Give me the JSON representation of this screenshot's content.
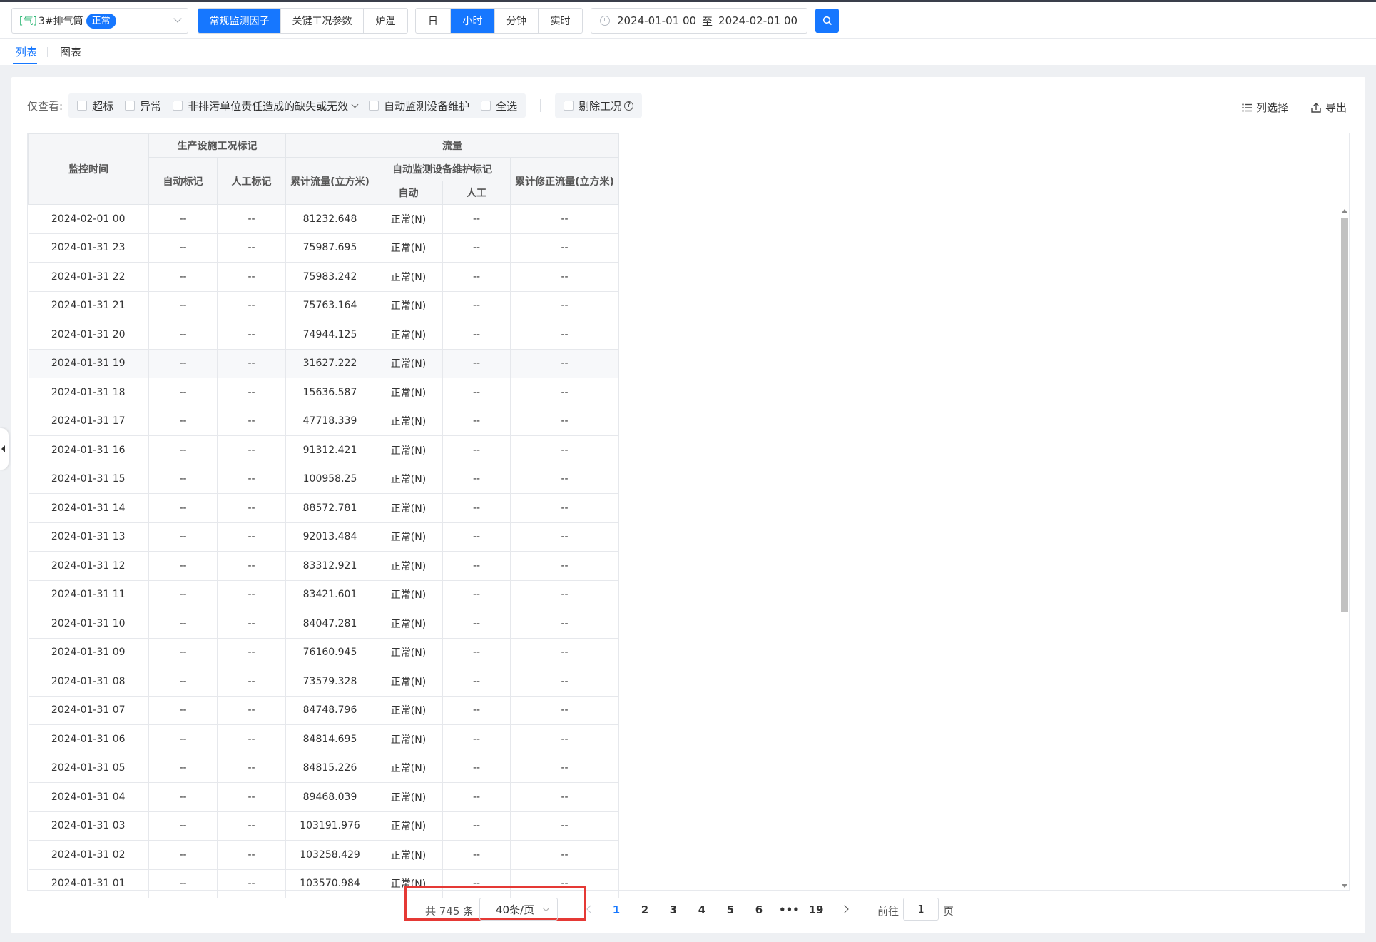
{
  "toolbar": {
    "outlet": {
      "type": "[气]",
      "name": "3#排气筒",
      "status": "正常"
    },
    "factor_tabs": [
      {
        "label": "常规监测因子",
        "active": true
      },
      {
        "label": "关键工况参数",
        "active": false
      },
      {
        "label": "炉温",
        "active": false
      }
    ],
    "granularity": [
      {
        "label": "日",
        "active": false
      },
      {
        "label": "小时",
        "active": true
      },
      {
        "label": "分钟",
        "active": false
      },
      {
        "label": "实时",
        "active": false
      }
    ],
    "date_start": "2024-01-01 00",
    "date_sep": "至",
    "date_end": "2024-02-01 00"
  },
  "view_tabs": [
    {
      "label": "列表",
      "active": true
    },
    {
      "label": "图表",
      "active": false
    }
  ],
  "filters": {
    "label": "仅查看:",
    "options": [
      "超标",
      "异常",
      "非排污单位责任造成的缺失或无效",
      "自动监测设备维护",
      "全选"
    ],
    "exclude": "剔除工况",
    "column_select": "列选择",
    "export": "导出"
  },
  "table": {
    "headers": {
      "time": "监控时间",
      "production_group": "生产设施工况标记",
      "auto_mark": "自动标记",
      "manual_mark": "人工标记",
      "flow_group": "流量",
      "cum_flow": "累计流量(立方米)",
      "maint_group": "自动监测设备维护标记",
      "maint_auto": "自动",
      "maint_manual": "人工",
      "cum_corrected": "累计修正流量(立方米)"
    },
    "rows": [
      [
        "2024-02-01 00",
        "--",
        "--",
        "81232.648",
        "正常(N)",
        "--",
        "--"
      ],
      [
        "2024-01-31 23",
        "--",
        "--",
        "75987.695",
        "正常(N)",
        "--",
        "--"
      ],
      [
        "2024-01-31 22",
        "--",
        "--",
        "75983.242",
        "正常(N)",
        "--",
        "--"
      ],
      [
        "2024-01-31 21",
        "--",
        "--",
        "75763.164",
        "正常(N)",
        "--",
        "--"
      ],
      [
        "2024-01-31 20",
        "--",
        "--",
        "74944.125",
        "正常(N)",
        "--",
        "--"
      ],
      [
        "2024-01-31 19",
        "--",
        "--",
        "31627.222",
        "正常(N)",
        "--",
        "--"
      ],
      [
        "2024-01-31 18",
        "--",
        "--",
        "15636.587",
        "正常(N)",
        "--",
        "--"
      ],
      [
        "2024-01-31 17",
        "--",
        "--",
        "47718.339",
        "正常(N)",
        "--",
        "--"
      ],
      [
        "2024-01-31 16",
        "--",
        "--",
        "91312.421",
        "正常(N)",
        "--",
        "--"
      ],
      [
        "2024-01-31 15",
        "--",
        "--",
        "100958.25",
        "正常(N)",
        "--",
        "--"
      ],
      [
        "2024-01-31 14",
        "--",
        "--",
        "88572.781",
        "正常(N)",
        "--",
        "--"
      ],
      [
        "2024-01-31 13",
        "--",
        "--",
        "92013.484",
        "正常(N)",
        "--",
        "--"
      ],
      [
        "2024-01-31 12",
        "--",
        "--",
        "83312.921",
        "正常(N)",
        "--",
        "--"
      ],
      [
        "2024-01-31 11",
        "--",
        "--",
        "83421.601",
        "正常(N)",
        "--",
        "--"
      ],
      [
        "2024-01-31 10",
        "--",
        "--",
        "84047.281",
        "正常(N)",
        "--",
        "--"
      ],
      [
        "2024-01-31 09",
        "--",
        "--",
        "76160.945",
        "正常(N)",
        "--",
        "--"
      ],
      [
        "2024-01-31 08",
        "--",
        "--",
        "73579.328",
        "正常(N)",
        "--",
        "--"
      ],
      [
        "2024-01-31 07",
        "--",
        "--",
        "84748.796",
        "正常(N)",
        "--",
        "--"
      ],
      [
        "2024-01-31 06",
        "--",
        "--",
        "84814.695",
        "正常(N)",
        "--",
        "--"
      ],
      [
        "2024-01-31 05",
        "--",
        "--",
        "84815.226",
        "正常(N)",
        "--",
        "--"
      ],
      [
        "2024-01-31 04",
        "--",
        "--",
        "89468.039",
        "正常(N)",
        "--",
        "--"
      ],
      [
        "2024-01-31 03",
        "--",
        "--",
        "103191.976",
        "正常(N)",
        "--",
        "--"
      ],
      [
        "2024-01-31 02",
        "--",
        "--",
        "103258.429",
        "正常(N)",
        "--",
        "--"
      ],
      [
        "2024-01-31 01",
        "--",
        "--",
        "103570.984",
        "正常(N)",
        "--",
        "--"
      ]
    ],
    "highlighted_row": 5
  },
  "pagination": {
    "total_text": "共 745 条",
    "page_size": "40条/页",
    "pages": [
      "1",
      "2",
      "3",
      "4",
      "5",
      "6",
      "•••",
      "19"
    ],
    "current": "1",
    "goto_label": "前往",
    "goto_value": "1",
    "goto_unit": "页"
  },
  "colors": {
    "primary": "#1677ff",
    "ok": "#1c9d2c",
    "highlight_box": "#e53935"
  }
}
